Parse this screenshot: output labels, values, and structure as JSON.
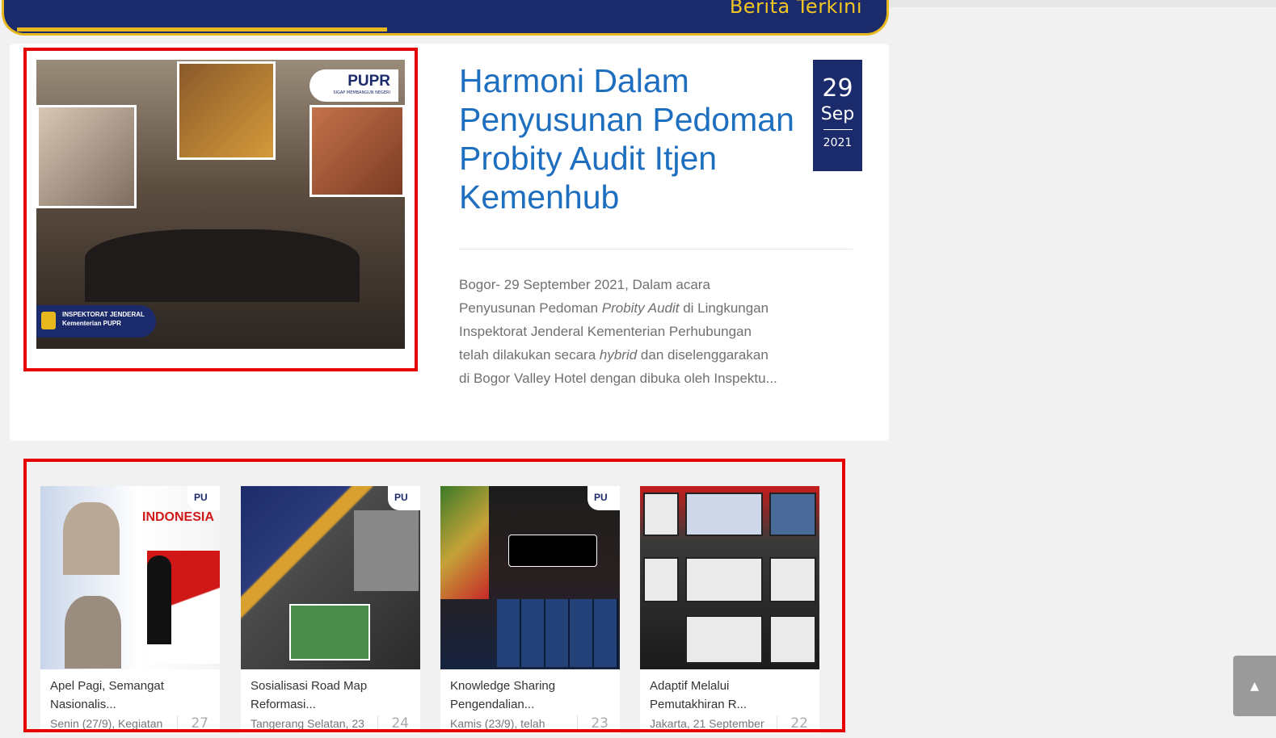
{
  "header": {
    "title": "Berita Terkini",
    "progress": 0.43
  },
  "featured": {
    "title": "Harmoni Dalam Penyusunan Pedoman Probity Audit Itjen Kemenhub",
    "date": {
      "day": "29",
      "month": "Sep",
      "year": "2021"
    },
    "image_badges": {
      "brand": "PUPR",
      "brand_tagline": "SIGAP MEMBANGUN NEGERI",
      "inspektorat_line1": "INSPEKTORAT JENDERAL",
      "inspektorat_line2": "Kementerian PUPR"
    },
    "excerpt": {
      "part1": "Bogor- 29 September 2021, Dalam acara Penyusunan Pedoman ",
      "em1": "Probity Audit",
      "part2": " di Lingkungan Inspektorat Jenderal Kementerian Perhubungan telah dilakukan secara ",
      "em2": "hybrid",
      "part3": " dan diselenggarakan di Bogor Valley Hotel dengan dibuka oleh Inspektu..."
    }
  },
  "cards": [
    {
      "title": "Apel Pagi, Semangat Nasionalis...",
      "meta": "Senin (27/9), Kegiatan",
      "day": "27",
      "thumb_text": "INDONESIA"
    },
    {
      "title": "Sosialisasi Road Map Reformasi...",
      "meta": "Tangerang Selatan, 23",
      "day": "24"
    },
    {
      "title": "Knowledge Sharing Pengendalian...",
      "meta": "Kamis (23/9), telah",
      "day": "23"
    },
    {
      "title": "Adaptif Melalui Pemutakhiran R...",
      "meta": "Jakarta, 21 September",
      "day": "22"
    }
  ],
  "mini_logo": "PU",
  "scroll_top": {
    "icon": "arrow-up-icon",
    "glyph": "▲"
  },
  "colors": {
    "navy": "#1a2a6b",
    "gold": "#e6b81e",
    "title_blue": "#1e6fbf",
    "highlight_red": "#e60000"
  }
}
